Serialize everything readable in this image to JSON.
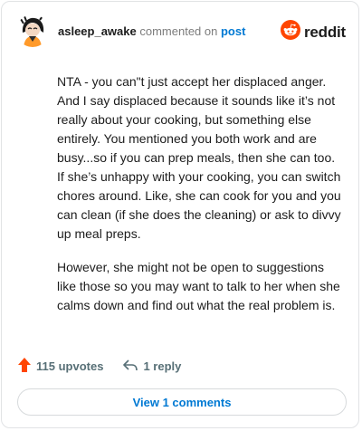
{
  "header": {
    "username": "asleep_awake",
    "verb": "commented on",
    "post_link": "post",
    "brand": "reddit"
  },
  "comment": {
    "paragraphs": [
      "NTA - you can\"t just accept her displaced anger. And I say displaced because it sounds like it’s not really about your cooking, but something else entirely. You mentioned you both work and are busy...so if you can prep meals, then she can too. If she’s unhappy with your cooking, you can switch chores around. Like, she can cook for you and you can clean (if she does the cleaning) or ask to divvy up meal preps.",
      "However, she might not be open to suggestions like those so you may want to talk to her when she calms down and find out what the real problem is."
    ]
  },
  "actions": {
    "upvotes": "115 upvotes",
    "reply": "1 reply"
  },
  "footer": {
    "view_comments": "View 1 comments"
  },
  "colors": {
    "accent": "#0079d3",
    "upvote": "#ff4500",
    "reddit_orange": "#ff4500"
  },
  "icons": [
    "avatar",
    "reddit-logo-icon",
    "upvote-arrow-icon",
    "reply-arrow-icon"
  ]
}
